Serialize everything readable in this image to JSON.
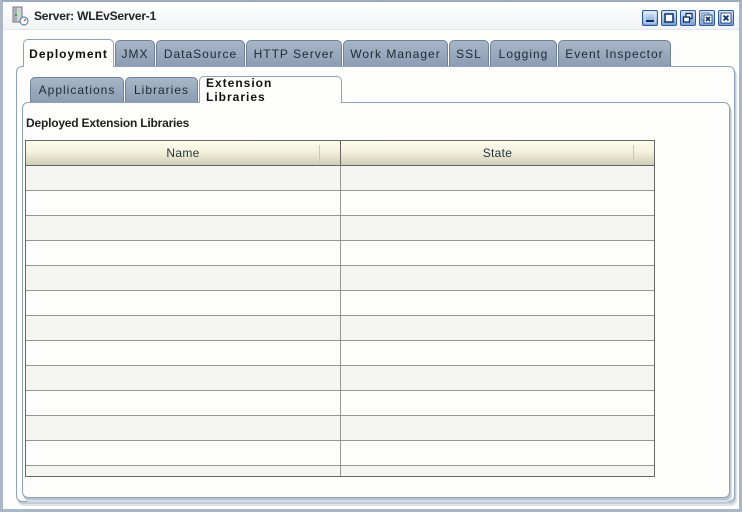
{
  "window": {
    "title": "Server: WLEvServer-1",
    "icon": "server-icon",
    "controls": [
      {
        "name": "minimize",
        "icon": "minimize-icon"
      },
      {
        "name": "maximize",
        "icon": "maximize-icon"
      },
      {
        "name": "restore",
        "icon": "restore-icon"
      },
      {
        "name": "close-panel",
        "icon": "close-panel-icon"
      },
      {
        "name": "close",
        "icon": "close-icon"
      }
    ]
  },
  "outer_tabs": [
    {
      "label": "Deployment",
      "active": true
    },
    {
      "label": "JMX",
      "active": false
    },
    {
      "label": "DataSource",
      "active": false
    },
    {
      "label": "HTTP Server",
      "active": false
    },
    {
      "label": "Work Manager",
      "active": false
    },
    {
      "label": "SSL",
      "active": false
    },
    {
      "label": "Logging",
      "active": false
    },
    {
      "label": "Event Inspector",
      "active": false
    }
  ],
  "inner_tabs": [
    {
      "label": "Applications",
      "active": false
    },
    {
      "label": "Libraries",
      "active": false
    },
    {
      "label": "Extension Libraries",
      "active": true
    }
  ],
  "section": {
    "title": "Deployed Extension Libraries"
  },
  "table": {
    "columns": [
      "Name",
      "State"
    ],
    "rows": [
      [
        "",
        ""
      ],
      [
        "",
        ""
      ],
      [
        "",
        ""
      ],
      [
        "",
        ""
      ],
      [
        "",
        ""
      ],
      [
        "",
        ""
      ],
      [
        "",
        ""
      ],
      [
        "",
        ""
      ],
      [
        "",
        ""
      ],
      [
        "",
        ""
      ],
      [
        "",
        ""
      ],
      [
        "",
        ""
      ],
      [
        "",
        ""
      ]
    ]
  }
}
